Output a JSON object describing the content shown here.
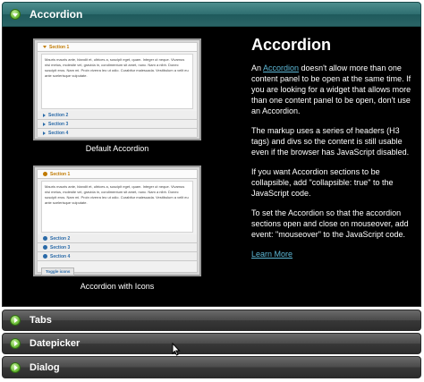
{
  "headers": {
    "accordion": "Accordion",
    "tabs": "Tabs",
    "datepicker": "Datepicker",
    "dialog": "Dialog"
  },
  "panel": {
    "title": "Accordion",
    "intro_pre": "An ",
    "intro_link": "Accordion",
    "intro_post": " doesn't allow more than one content panel to be open at the same time. If you are looking for a widget that allows more than one content panel to be open, don't use an Accordion.",
    "para2": "The markup uses a series of headers (H3 tags) and divs so the content is still usable even if the browser has JavaScript disabled.",
    "para3": "If you want Accordion sections to be collapsible, add \"collapsible: true\" to the JavaScript code.",
    "para4": "To set the Accordion so that the accordion sections open and close on mouseover, add event: \"mouseover\" to the JavaScript code.",
    "learn_more": "Learn More"
  },
  "thumb_default": {
    "caption": "Default Accordion",
    "sections": [
      "Section 1",
      "Section 2",
      "Section 3",
      "Section 4"
    ],
    "body": "Mauris mauris ante, blandit et, ultrices a, suscipit eget, quam. Integer ut neque. Vivamus nisi metus, molestie vel, gravida in, condimentum sit amet, nunc. Nam a nibh. Donec suscipit eros. Nam mi. Proin viverra leo ut odio. Curabitur malesuada. Vestibulum a velit eu ante scelerisque vulputate."
  },
  "thumb_icons": {
    "caption": "Accordion with Icons",
    "sections": [
      "Section 1",
      "Section 2",
      "Section 3",
      "Section 4"
    ],
    "body": "Mauris mauris ante, blandit et, ultrices a, suscipit eget, quam. Integer ut neque. Vivamus nisi metus, molestie vel, gravida in, condimentum sit amet, nunc. Nam a nibh. Donec suscipit eros. Nam mi. Proin viverra leo ut odio. Curabitur malesuada. Vestibulum a velit eu ante scelerisque vulputate.",
    "toggle_label": "Toggle icons"
  },
  "icons": {
    "header_icon": "circle-triangle-icon",
    "cursor": "mouse-pointer-icon"
  },
  "colors": {
    "active_header": "#2e6e70",
    "inactive_header": "#3a3a3a",
    "panel_bg": "#000000",
    "link": "#5db8d6"
  }
}
